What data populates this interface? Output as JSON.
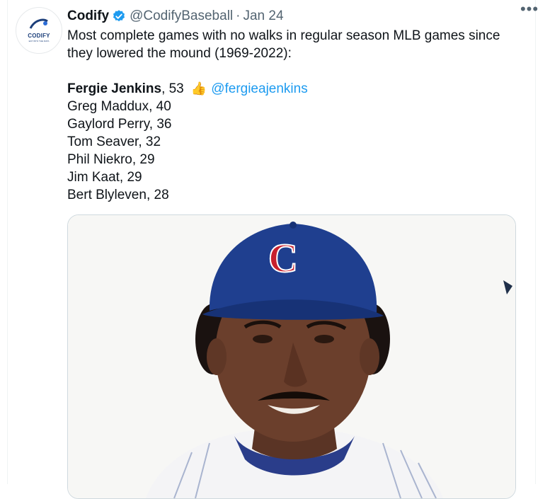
{
  "author": {
    "name": "Codify",
    "handle": "@CodifyBaseball",
    "separator": "·",
    "date": "Jan 24",
    "avatar_brand": "CODIFY",
    "avatar_tagline": "EAT INTO THE DATA"
  },
  "menu": {
    "more_label": "•••"
  },
  "tweet": {
    "line1": "Most complete games with no walks in regular season MLB games since",
    "line2": "they lowered the mound (1969-2022):",
    "list": [
      {
        "name": "Fergie Jenkins",
        "value": ", 53",
        "emoji": "👍",
        "mention": "@fergieajenkins"
      },
      {
        "text": "Greg Maddux, 40"
      },
      {
        "text": "Gaylord Perry, 36"
      },
      {
        "text": "Tom Seaver, 32"
      },
      {
        "text": "Phil Niekro, 29"
      },
      {
        "text": "Jim Kaat, 29"
      },
      {
        "text": "Bert Blyleven, 28"
      }
    ]
  },
  "media": {
    "cap_letter": "C",
    "colors": {
      "cap": "#1f3f8f",
      "logo": "#c8202e"
    }
  }
}
